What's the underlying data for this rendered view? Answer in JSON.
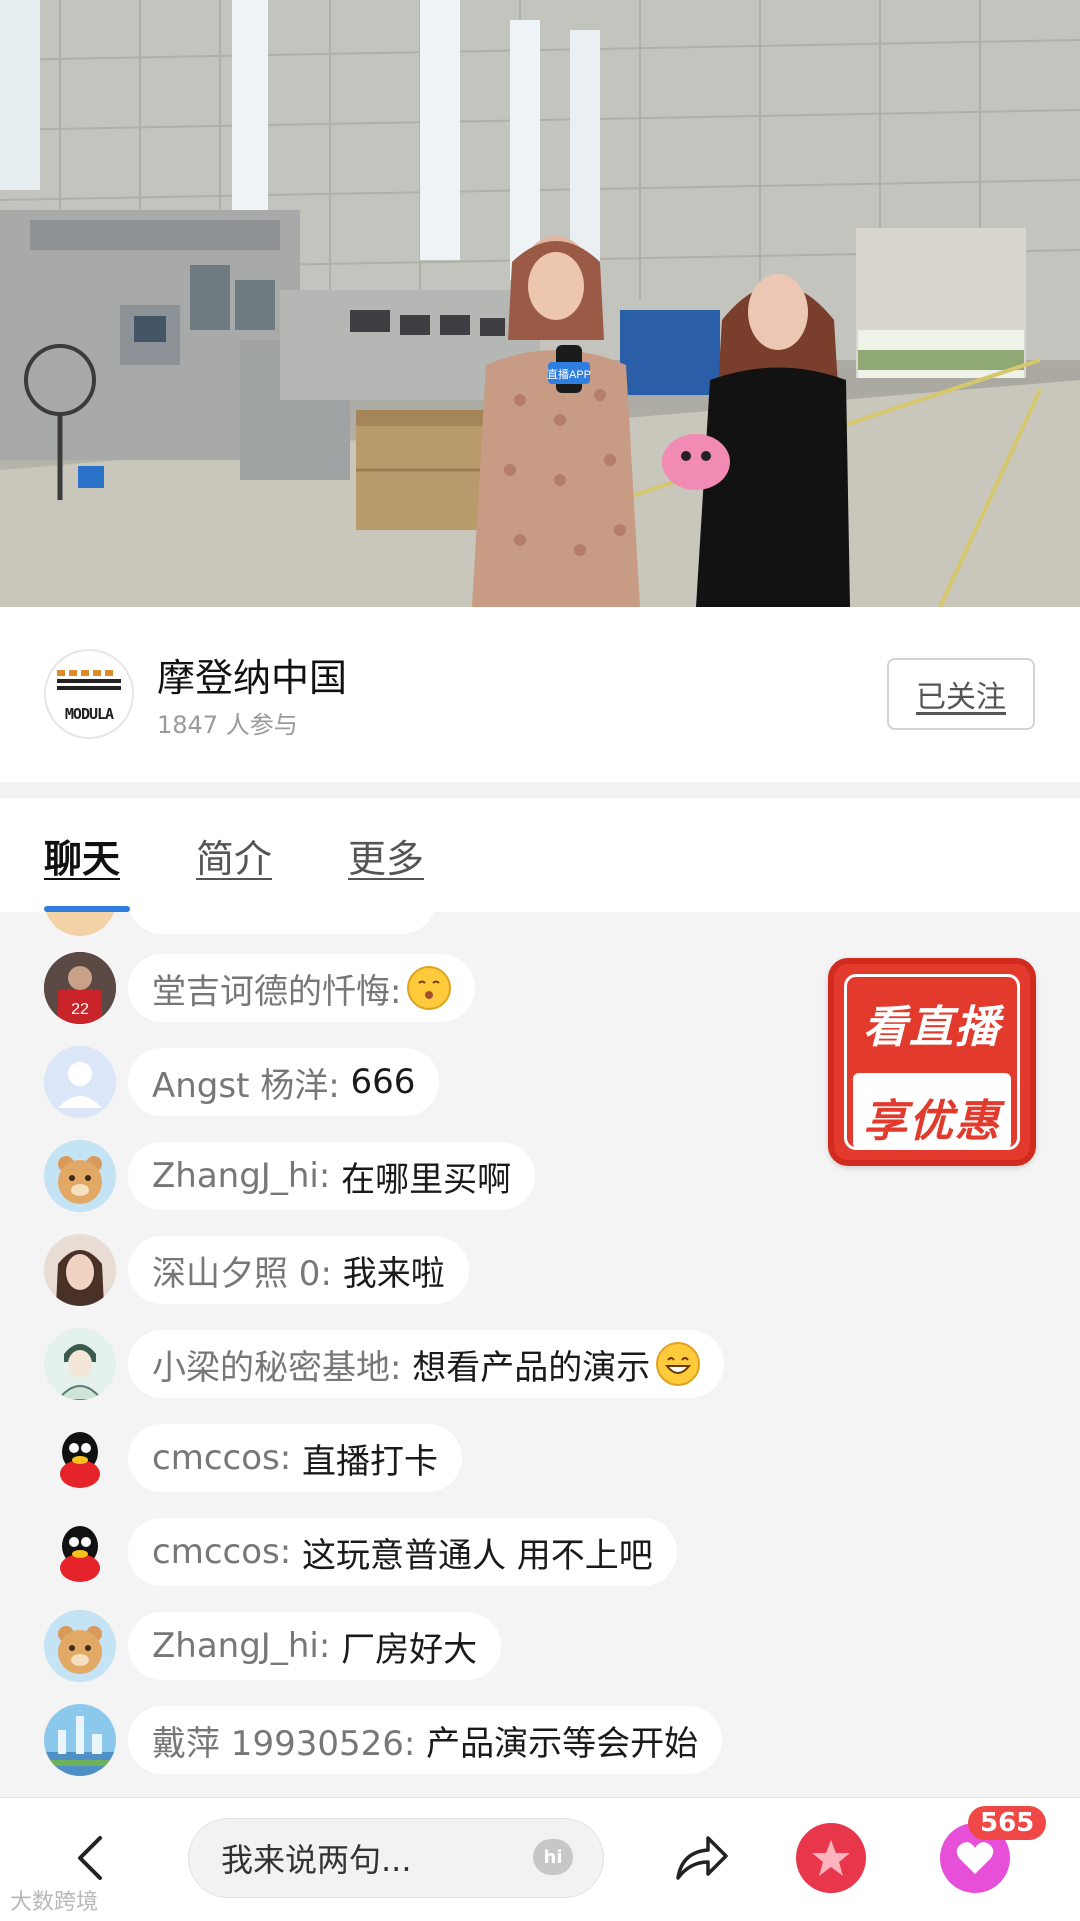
{
  "channel": {
    "name": "摩登纳中国",
    "participants": "1847 人参与",
    "follow_label": "已关注",
    "logo_text": "MODULA"
  },
  "tabs": [
    {
      "label": "聊天"
    },
    {
      "label": "简介"
    },
    {
      "label": "更多"
    }
  ],
  "chat": {
    "messages": [
      {
        "user": "堂吉诃德的忏悔:",
        "text": "",
        "emoji": "kiss-emoji"
      },
      {
        "user": "Angst 杨洋:",
        "text": "666"
      },
      {
        "user": "ZhangJ_hi:",
        "text": "在哪里买啊"
      },
      {
        "user": "深山夕照 0:",
        "text": "我来啦"
      },
      {
        "user": "小梁的秘密基地:",
        "text": "想看产品的演示",
        "emoji": "grin-emoji"
      },
      {
        "user": "cmccos:",
        "text": "直播打卡"
      },
      {
        "user": "cmccos:",
        "text": "这玩意普通人 用不上吧"
      },
      {
        "user": "ZhangJ_hi:",
        "text": "厂房好大"
      },
      {
        "user": "戴萍 19930526:",
        "text": "产品演示等会开始"
      }
    ]
  },
  "promo": {
    "line1": "看直播",
    "line2": "享优惠"
  },
  "bottom": {
    "input_placeholder": "我来说两句...",
    "hi_label": "hi",
    "like_count": "565"
  },
  "watermark": "大数跨境",
  "video": {
    "mic_label": "直播APP"
  },
  "colors": {
    "tab_indicator": "#2f7dde",
    "promo_red": "#e23b2e",
    "gift": "#e8364a",
    "like": "#e84fd8",
    "badge": "#f04747"
  }
}
